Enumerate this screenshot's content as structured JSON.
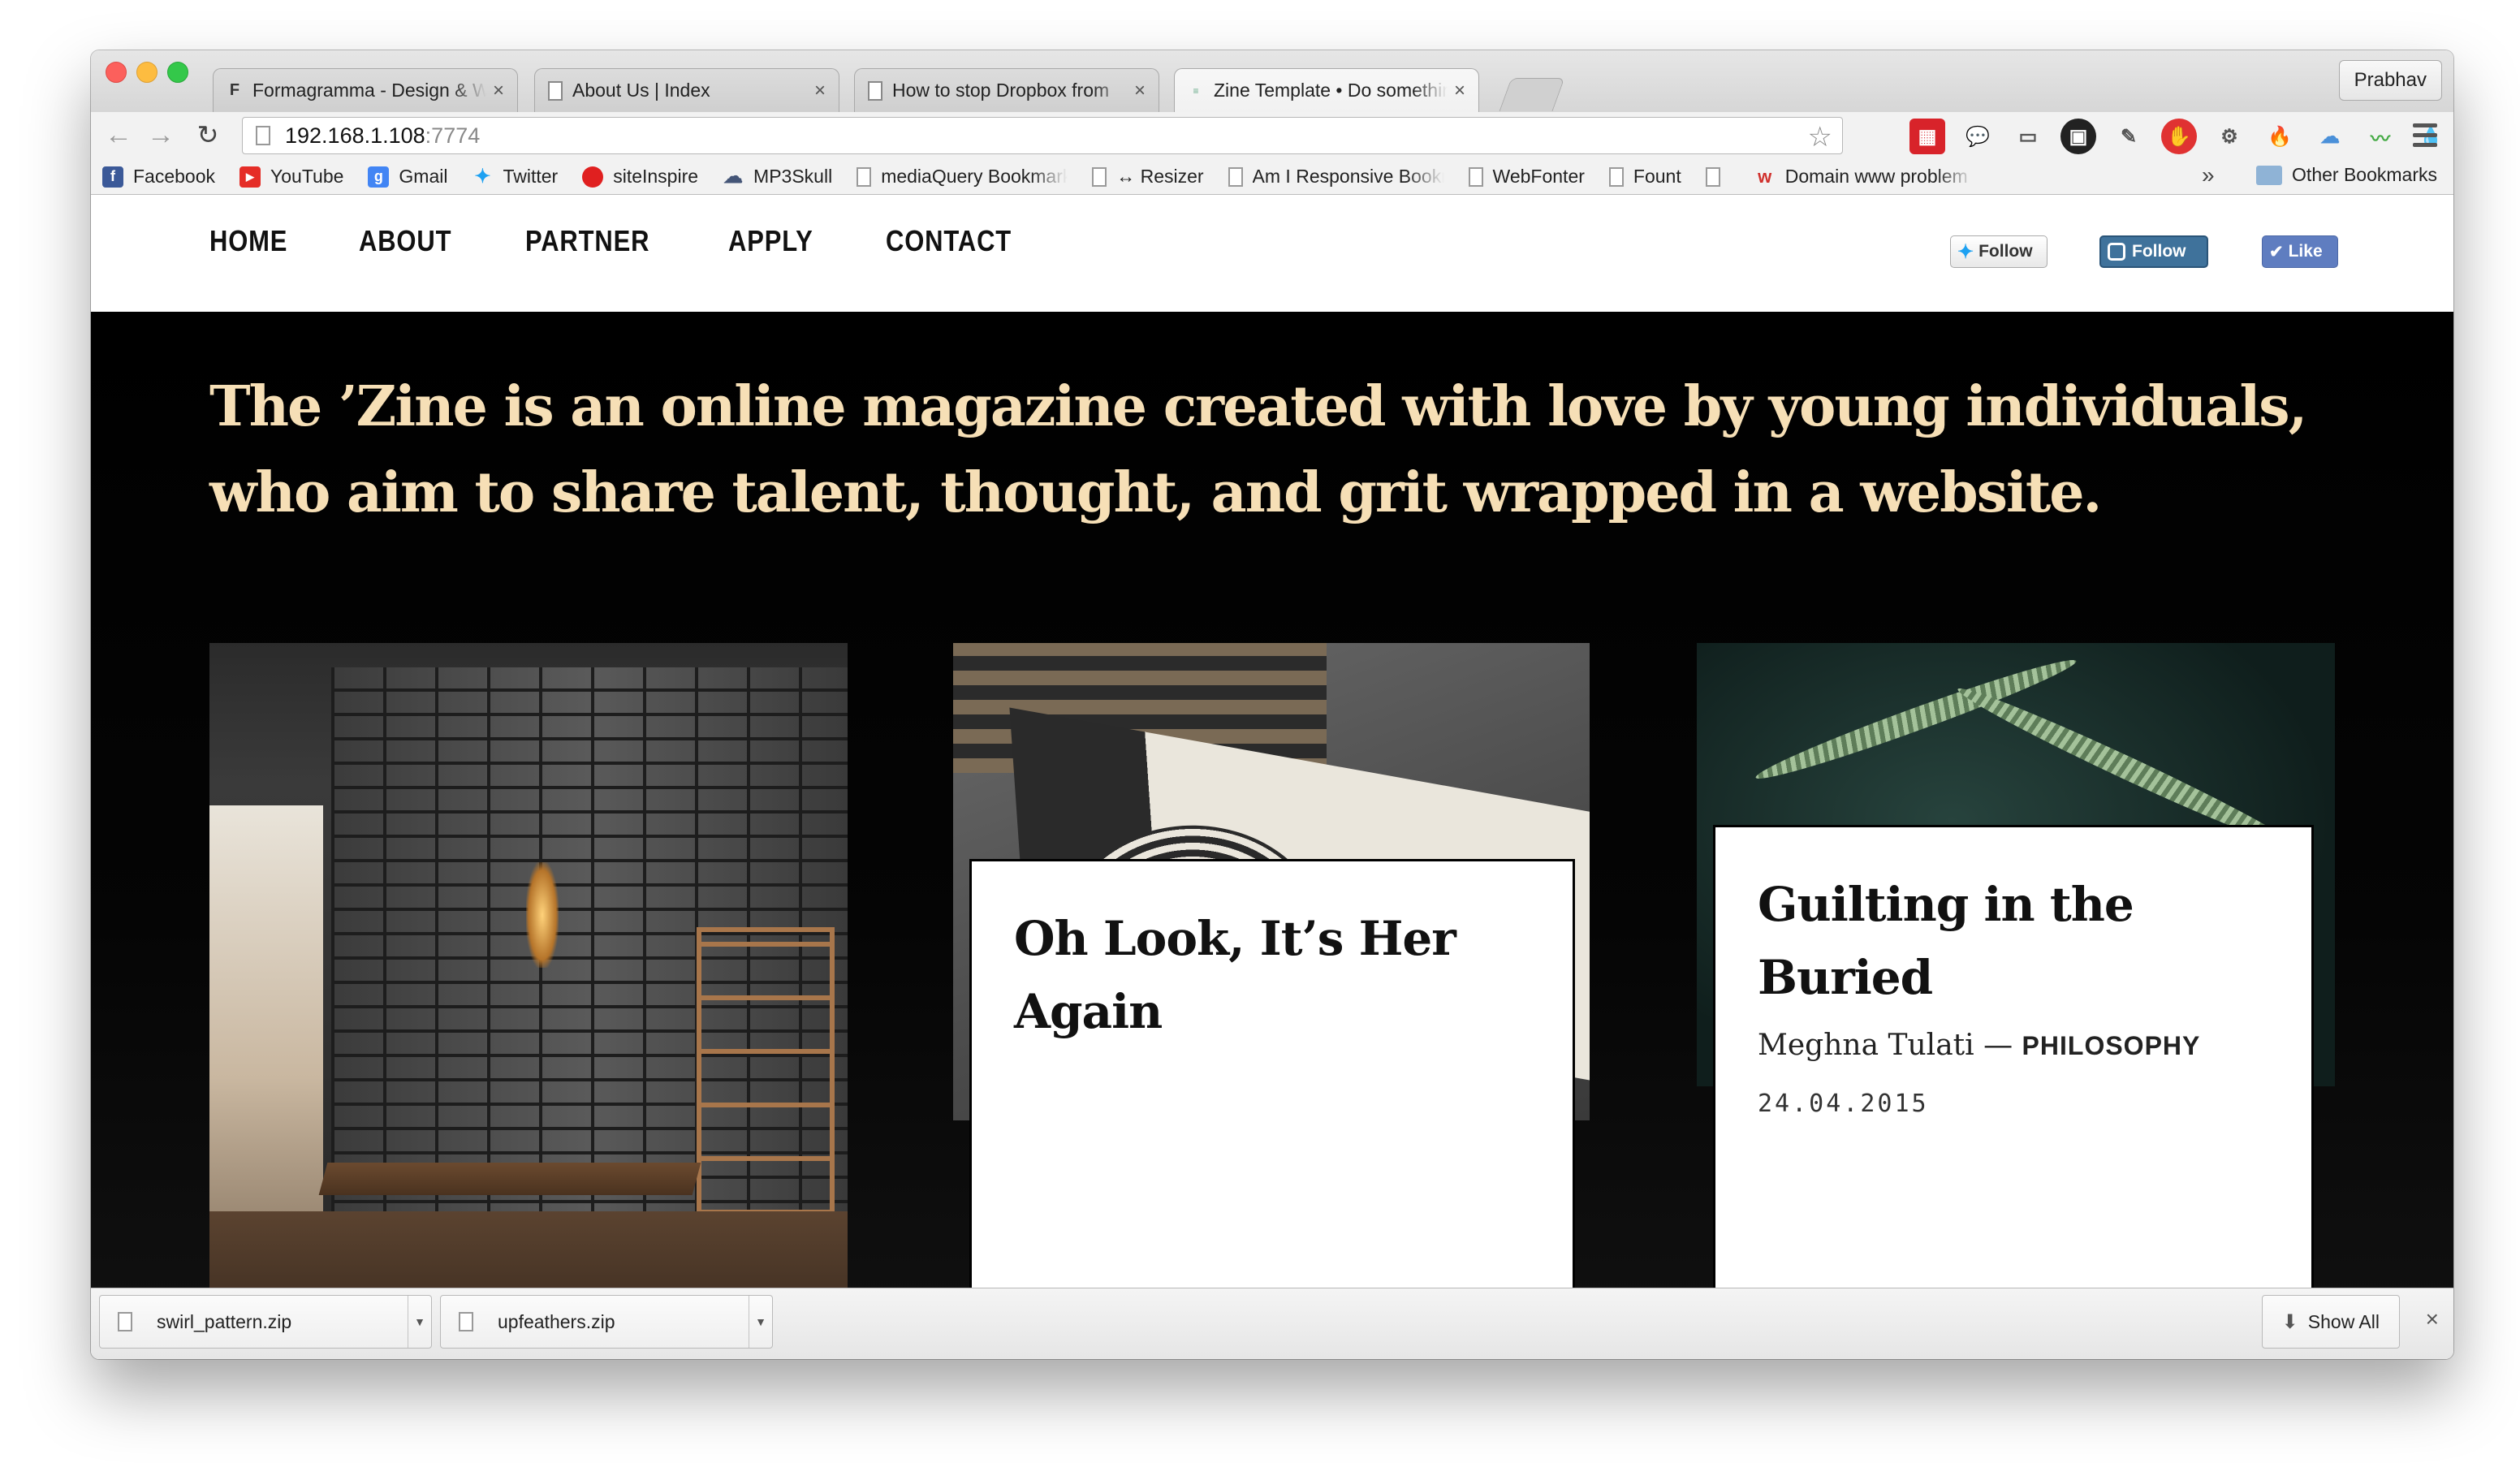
{
  "browser": {
    "profile_name": "Prabhav",
    "tabs": [
      {
        "favicon": "F",
        "title": "Formagramma - Design & Web"
      },
      {
        "favicon": "",
        "title": "About Us | Index"
      },
      {
        "favicon": "",
        "title": "How to stop Dropbox from"
      },
      {
        "favicon": "",
        "title": "Zine Template • Do something"
      }
    ],
    "url_host": "192.168.1.108",
    "url_port": ":7774",
    "bookmarks": [
      {
        "label": "Facebook",
        "icon": "facebook-icon",
        "color": "#3b5998",
        "glyph": "f"
      },
      {
        "label": "YouTube",
        "icon": "youtube-icon",
        "color": "#e52d27",
        "glyph": "▶"
      },
      {
        "label": "Gmail",
        "icon": "google-icon",
        "color": "#4285f4",
        "glyph": "g"
      },
      {
        "label": "Twitter",
        "icon": "twitter-icon",
        "color": "#1da1f2",
        "glyph": "✦"
      },
      {
        "label": "siteInspire",
        "icon": "siteinspire-icon",
        "color": "#e02020",
        "glyph": "●"
      },
      {
        "label": "MP3Skull",
        "icon": "mp3skull-icon",
        "color": "#445577",
        "glyph": "☁"
      },
      {
        "label": "mediaQuery Bookmarklet",
        "icon": "page-icon",
        "color": "",
        "glyph": ""
      },
      {
        "label": "↔ Resizer",
        "icon": "page-icon",
        "color": "",
        "glyph": ""
      },
      {
        "label": "Am I Responsive Bookmarklet",
        "icon": "page-icon",
        "color": "",
        "glyph": ""
      },
      {
        "label": "WebFonter",
        "icon": "page-icon",
        "color": "",
        "glyph": ""
      },
      {
        "label": "Fount",
        "icon": "page-icon",
        "color": "",
        "glyph": ""
      },
      {
        "label": "Domain www problem",
        "icon": "w-icon",
        "color": "#d0312d",
        "glyph": "w"
      }
    ],
    "bookmarks_more": "»",
    "other_bookmarks": "Other Bookmarks"
  },
  "site": {
    "nav": [
      "HOME",
      "ABOUT",
      "PARTNER",
      "APPLY",
      "CONTACT"
    ],
    "social": {
      "twitter": "Follow",
      "instagram": "Follow",
      "facebook": "Like"
    },
    "tagline": "The ’Zine is an online magazine created with love by young individuals, who aim to share talent, thought, and grit wrapped in a website.",
    "cards": [
      {
        "title": "Oh Look, It’s Her Again"
      },
      {
        "title": "Guilting in the Buried",
        "author": "Meghna Tulati",
        "separator": " — ",
        "category": "PHILOSOPHY",
        "date": "24.04.2015"
      }
    ]
  },
  "downloads": {
    "items": [
      "swirl_pattern.zip",
      "upfeathers.zip"
    ],
    "show_all": "Show All",
    "close": "×"
  },
  "colors": {
    "tagline": "#f6dfb6",
    "hero_bg": "#000000",
    "instagram": "#3f729b",
    "facebook": "#5f7dc0"
  }
}
